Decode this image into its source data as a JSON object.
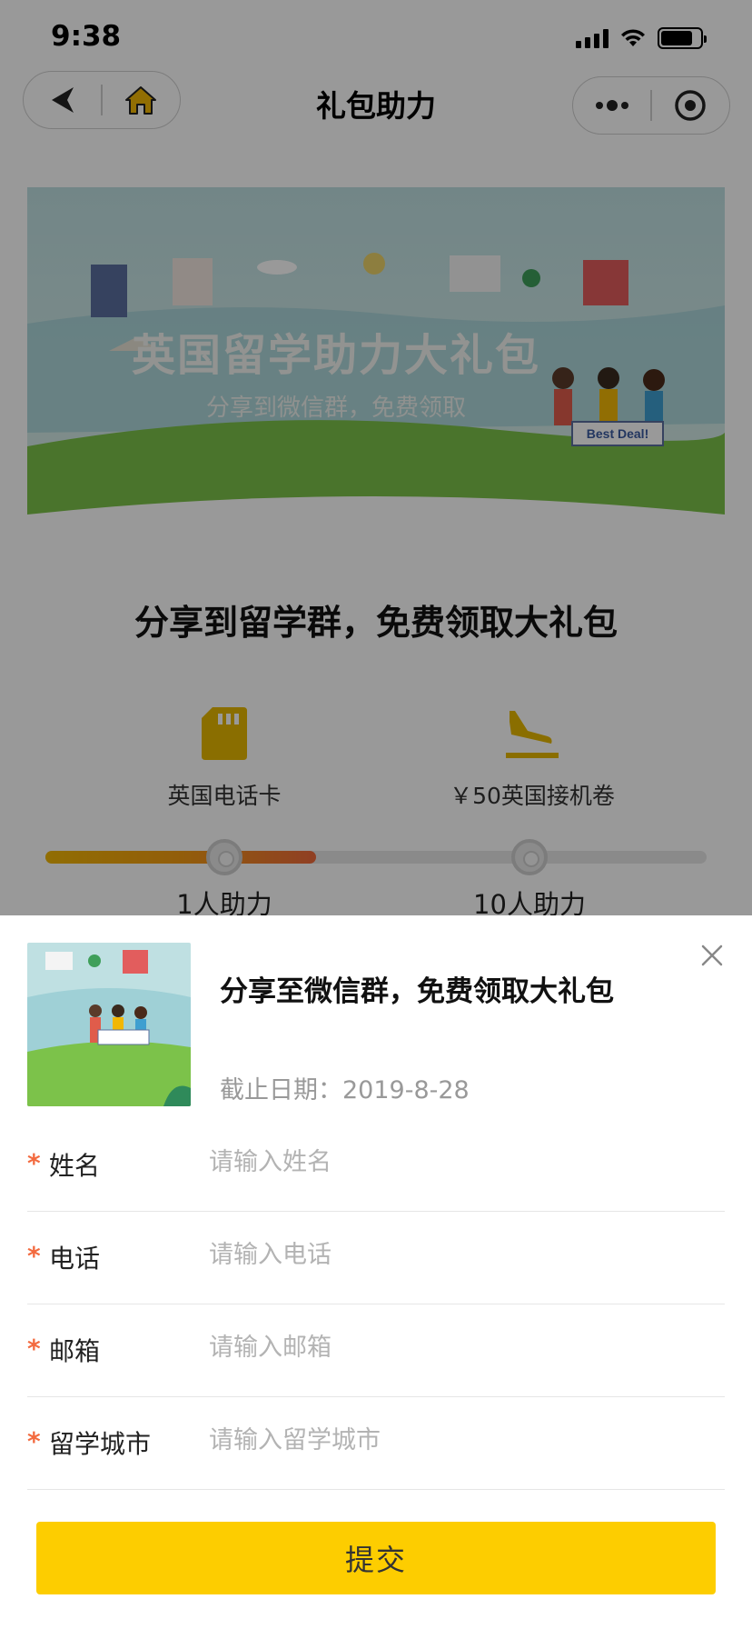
{
  "status_bar": {
    "time": "9:38"
  },
  "nav": {
    "title": "礼包助力"
  },
  "banner": {
    "title": "英国留学助力大礼包",
    "subtitle": "分享到微信群，免费领取",
    "sign_text": "Best Deal!"
  },
  "main": {
    "heading": "分享到留学群，免费领取大礼包",
    "rewards": [
      {
        "icon": "sim-card-icon",
        "label": "英国电话卡"
      },
      {
        "icon": "plane-landing-icon",
        "label": "￥50英国接机卷"
      }
    ],
    "progress": {
      "fill_fraction": 0.41,
      "milestones": [
        "1人助力",
        "10人助力"
      ]
    }
  },
  "sheet": {
    "title": "分享至微信群，免费领取大礼包",
    "date_label": "截止日期：",
    "date_value": "2019-8-28",
    "fields": [
      {
        "label": "姓名",
        "placeholder": "请输入姓名",
        "required_mark": "*"
      },
      {
        "label": "电话",
        "placeholder": "请输入电话",
        "required_mark": "*"
      },
      {
        "label": "邮箱",
        "placeholder": "请输入邮箱",
        "required_mark": "*"
      },
      {
        "label": "留学城市",
        "placeholder": "请输入留学城市",
        "required_mark": "*"
      }
    ],
    "submit_label": "提交"
  },
  "colors": {
    "accent": "#fdcd00",
    "required": "#f36a3f",
    "icon_gold": "#e6b800",
    "overlay": "rgba(0,0,0,0.40)"
  }
}
